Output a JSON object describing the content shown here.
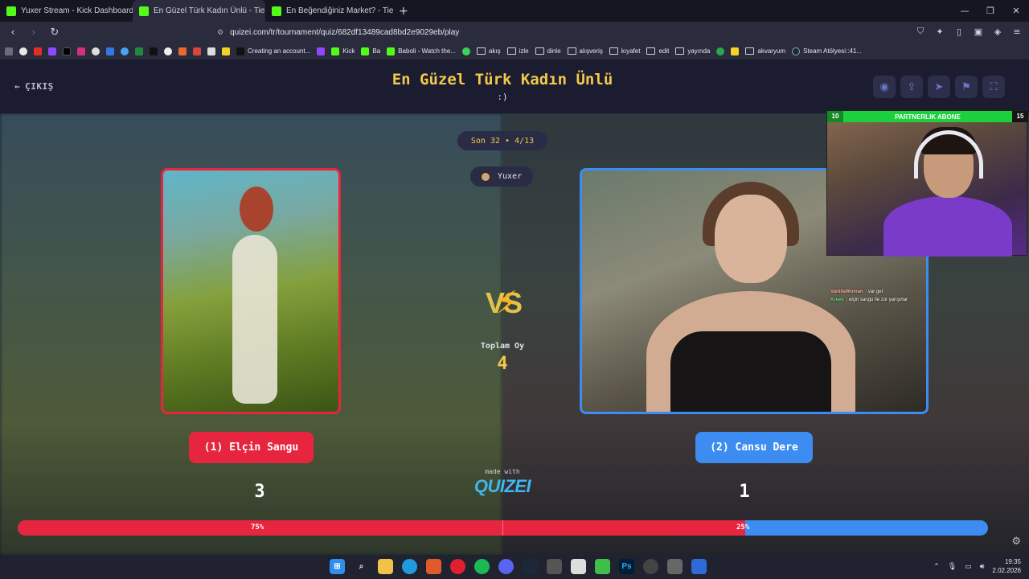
{
  "browser": {
    "tabs": [
      {
        "label": "Yuxer Stream - Kick Dashboard",
        "color": "#53fc18"
      },
      {
        "label": "En Güzel Türk Kadın Ünlü - Tier l",
        "color": "#53fc18"
      },
      {
        "label": "En Beğendiğiniz Market? - Tier List | \\",
        "color": "#53fc18"
      }
    ],
    "url": "quizei.com/tr/tournament/quiz/682df13489cad8bd2e9029eb/play",
    "bookmarks": [
      {
        "label": "Creating an account...",
        "type": "site"
      },
      {
        "label": "Kick",
        "type": "site"
      },
      {
        "label": "Ba",
        "type": "site"
      },
      {
        "label": "Baboli - Watch the...",
        "type": "site"
      },
      {
        "label": "akış",
        "type": "folder"
      },
      {
        "label": "izle",
        "type": "folder"
      },
      {
        "label": "dinle",
        "type": "folder"
      },
      {
        "label": "alışveriş",
        "type": "folder"
      },
      {
        "label": "kıyafet",
        "type": "folder"
      },
      {
        "label": "edit",
        "type": "folder"
      },
      {
        "label": "yayında",
        "type": "folder"
      },
      {
        "label": "akvaryum",
        "type": "folder"
      },
      {
        "label": "Steam Atölyesi::41...",
        "type": "site"
      }
    ]
  },
  "page": {
    "exit_label": "ÇIKIŞ",
    "title": "En Güzel Türk Kadın Ünlü",
    "subtitle": ":)",
    "round": "Son 32 • 4/13",
    "user": "Yuxer",
    "vs_label": "VS",
    "total_label": "Toplam Oy",
    "total_value": "4",
    "left": {
      "choice": "(1) Elçin Sangu",
      "votes": "3",
      "percent": "75%",
      "share": 0.75
    },
    "right": {
      "choice": "(2) Cansu Dere",
      "votes": "1",
      "percent": "25%"
    },
    "made_with": "made with",
    "logo": "QUIZEI",
    "colors": {
      "left": "#e8253f",
      "right": "#3c8cf2",
      "accent": "#f2c94c"
    }
  },
  "overlay": {
    "bar_left": "10",
    "bar_middle": "PARTNERLIK ABONE",
    "bar_right": "15",
    "chat": [
      {
        "user": "VanillaWoman",
        "message": ": var gel"
      },
      {
        "user": "Kreek",
        "message": ": elçin sangu ile zor yarışırlar"
      }
    ]
  },
  "taskbar": {
    "time": "19:35",
    "date": "2.02.2026"
  }
}
